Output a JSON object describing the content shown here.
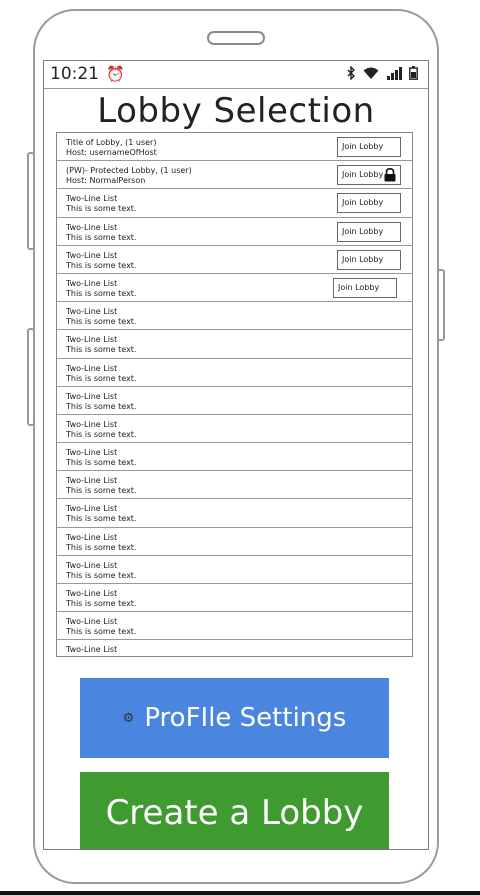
{
  "status_bar": {
    "time": "10:21",
    "alarm_icon": "alarm-icon",
    "icons": [
      "bluetooth-icon",
      "wifi-icon",
      "signal-icon",
      "battery-icon"
    ]
  },
  "page": {
    "title": "Lobby Selection"
  },
  "lobbies": [
    {
      "line1": "Title of Lobby, (1 user)",
      "line2": "Host: usernameOfHost",
      "join_label": "Join Lobby",
      "locked": false
    },
    {
      "line1": "(PW)- Protected Lobby, (1 user)",
      "line2": "Host: NormalPerson",
      "join_label": "Join Lobby",
      "locked": true
    },
    {
      "line1": "Two-Line List",
      "line2": "This is some text.",
      "join_label": "Join Lobby",
      "locked": false
    },
    {
      "line1": "Two-Line List",
      "line2": "This is some text.",
      "join_label": "Join Lobby",
      "locked": false
    },
    {
      "line1": "Two-Line List",
      "line2": "This is some text.",
      "join_label": "Join Lobby",
      "locked": false
    },
    {
      "line1": "Two-Line List",
      "line2": "This is some text.",
      "join_label": "Join Lobby",
      "locked": false
    },
    {
      "line1": "Two-Line List",
      "line2": "This is some text."
    },
    {
      "line1": "Two-Line List",
      "line2": "This is some text."
    },
    {
      "line1": "Two-Line List",
      "line2": "This is some text."
    },
    {
      "line1": "Two-Line List",
      "line2": "This is some text."
    },
    {
      "line1": "Two-Line List",
      "line2": "This is some text."
    },
    {
      "line1": "Two-Line List",
      "line2": "This is some text."
    },
    {
      "line1": "Two-Line List",
      "line2": "This is some text."
    },
    {
      "line1": "Two-Line List",
      "line2": "This is some text."
    },
    {
      "line1": "Two-Line List",
      "line2": "This is some text."
    },
    {
      "line1": "Two-Line List",
      "line2": "This is some text."
    },
    {
      "line1": "Two-Line List",
      "line2": "This is some text."
    },
    {
      "line1": "Two-Line List",
      "line2": "This is some text."
    },
    {
      "line1": "Two-Line List",
      "line2": ""
    }
  ],
  "buttons": {
    "profile_label": "ProFIle Settings",
    "profile_icon": "gear-icon",
    "create_label": "Create a Lobby"
  },
  "colors": {
    "profile_button": "#4a86e0",
    "create_button": "#3f9a30"
  }
}
